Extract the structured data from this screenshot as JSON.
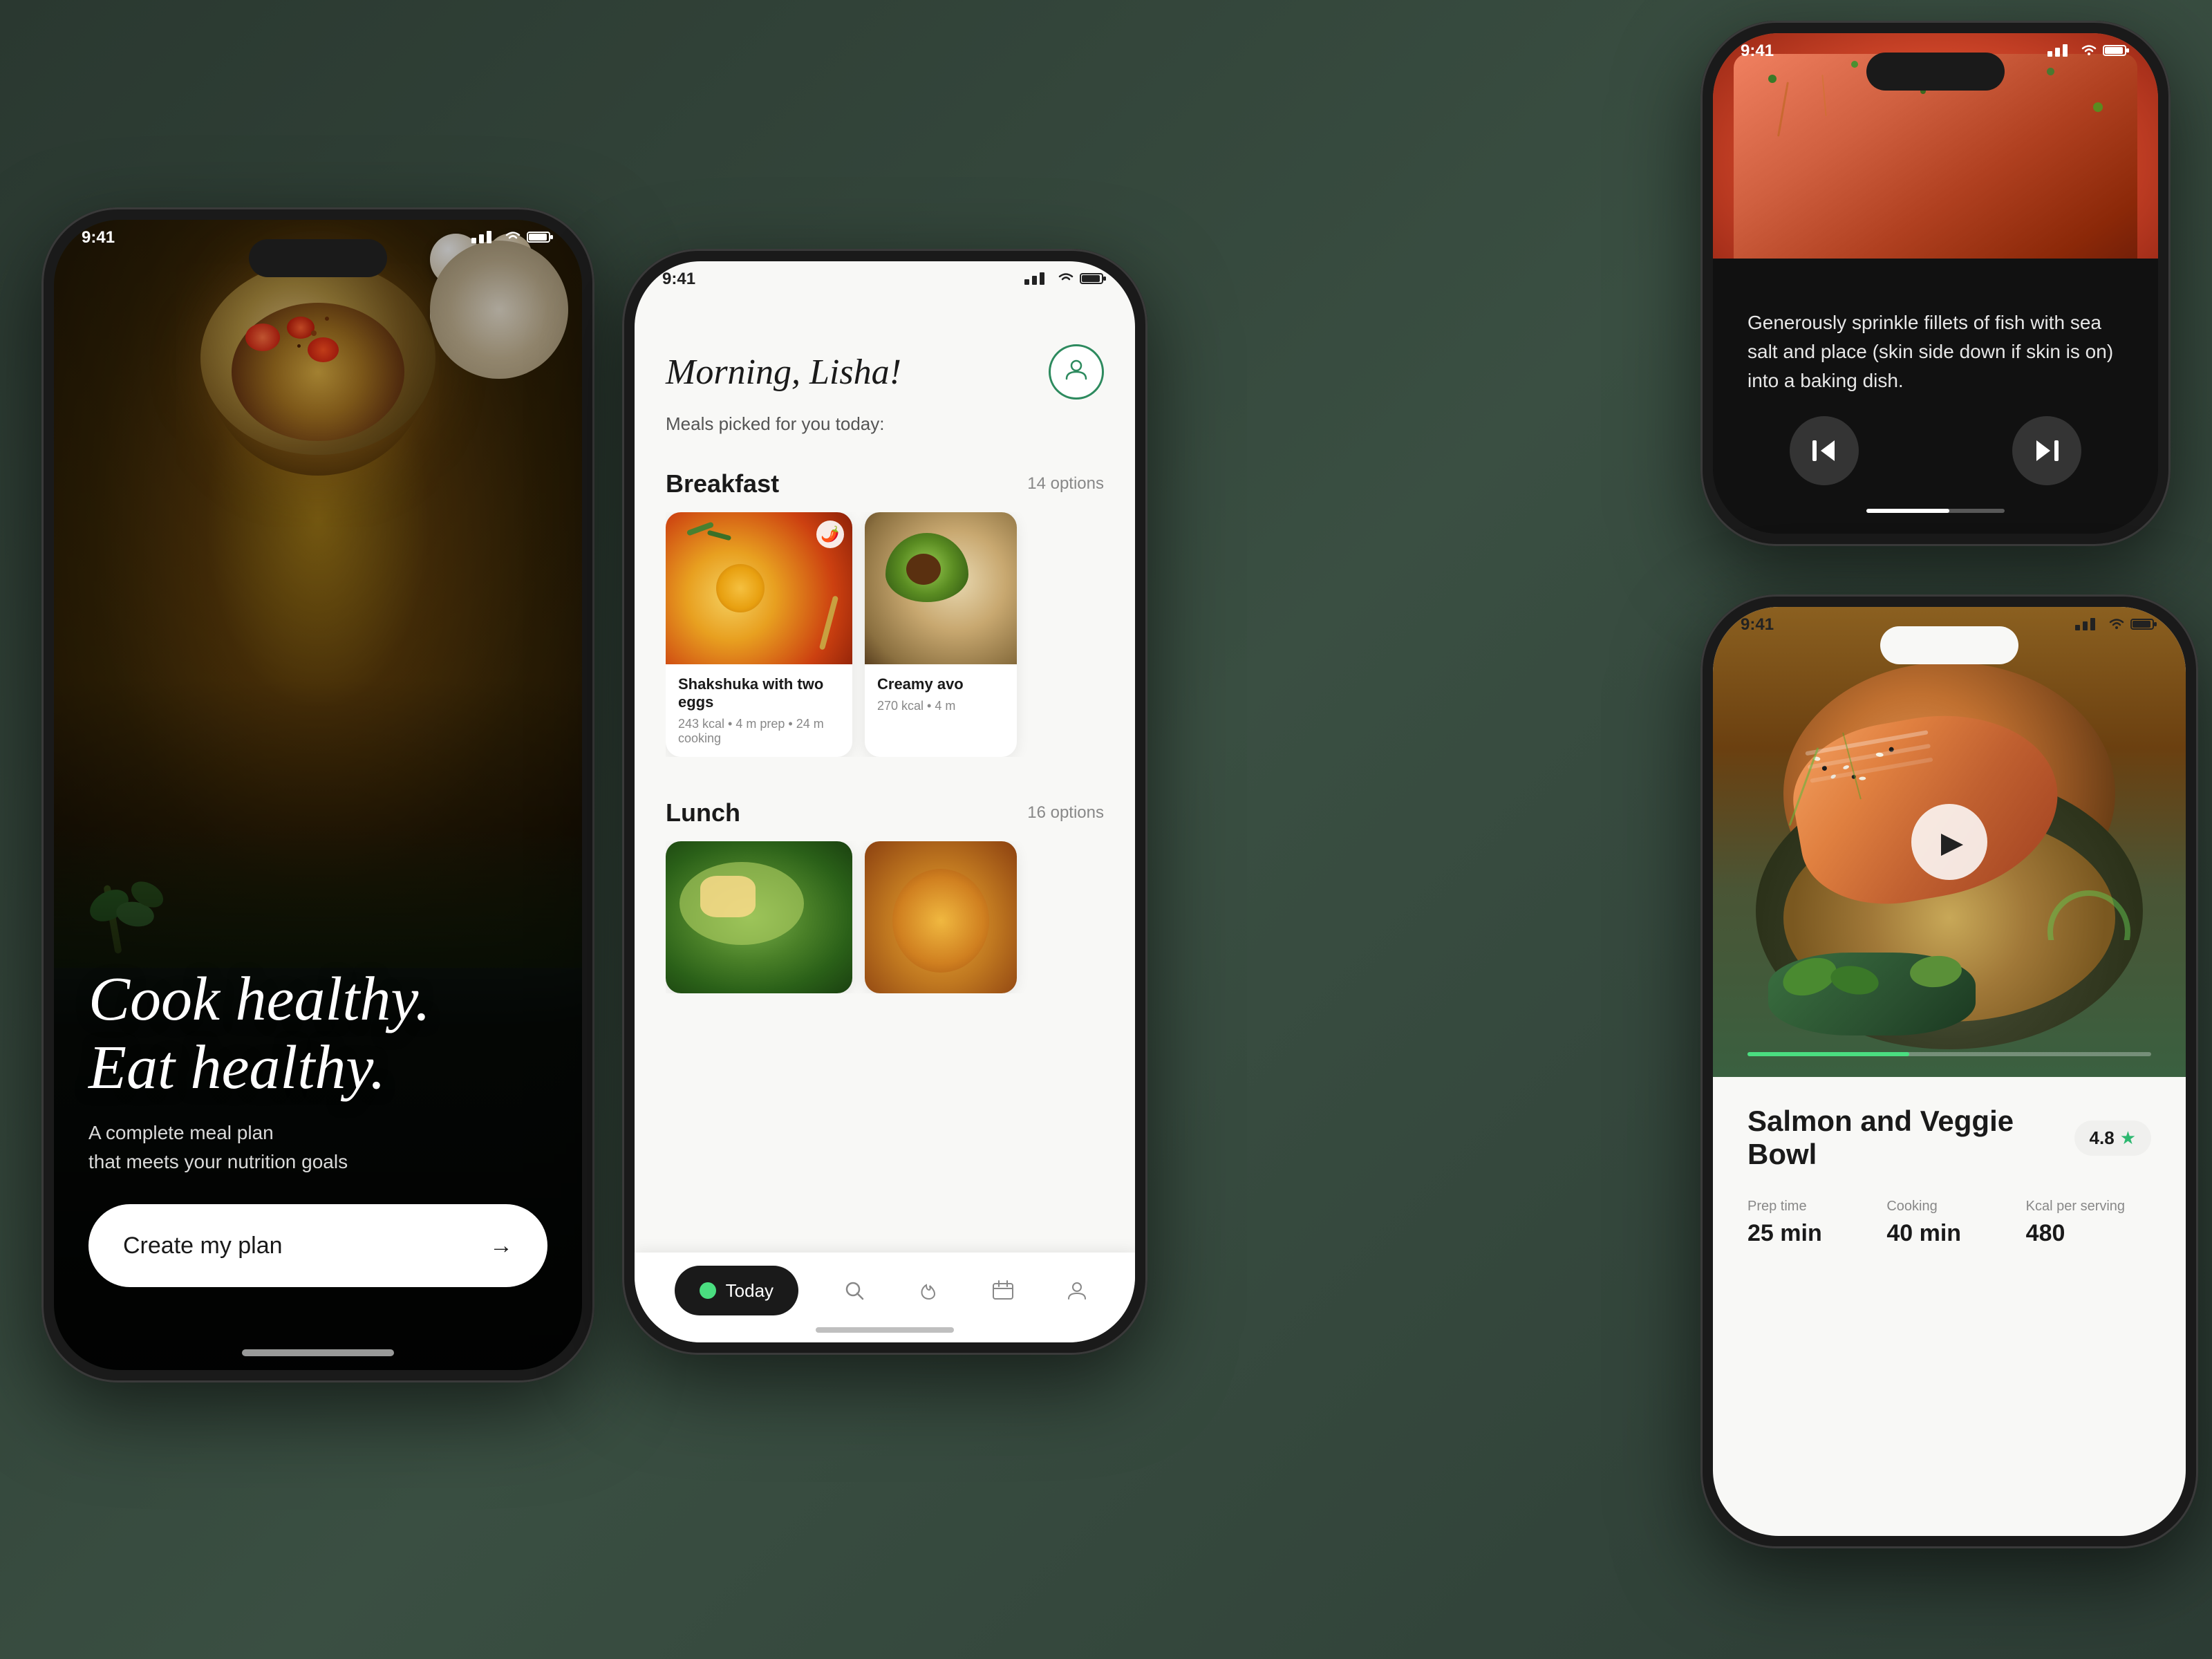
{
  "bg": {
    "color": "#2d3d35"
  },
  "phone1": {
    "status": {
      "time": "9:41",
      "color_class": "white"
    },
    "headline_line1": "Cook healthy.",
    "headline_line2": "Eat healthy.",
    "subtitle_line1": "A complete meal plan",
    "subtitle_line2": "that meets your nutrition goals",
    "cta_label": "Create my plan",
    "cta_arrow": "→"
  },
  "phone2": {
    "status": {
      "time": "9:41",
      "color_class": "dark"
    },
    "greeting": "Morning, Lisha!",
    "subtitle": "Meals picked for you today:",
    "breakfast": {
      "title": "Breakfast",
      "options": "14 options",
      "cards": [
        {
          "name": "Shakshuka with two eggs",
          "kcal": "243 kcal",
          "prep": "4 m prep",
          "cook": "24 m cooking",
          "spicy": true
        },
        {
          "name": "Creamy avo",
          "kcal": "270 kcal",
          "prep": "4 m",
          "cook": "",
          "spicy": false
        }
      ]
    },
    "lunch": {
      "title": "Lunch",
      "options": "16 options"
    },
    "nav": {
      "today_label": "Today",
      "icons": [
        "search",
        "flame",
        "calendar",
        "person"
      ]
    }
  },
  "phone3": {
    "status": {
      "time": "9:41",
      "color_class": "white"
    },
    "instruction": "Generously sprinkle fillets of fish with sea salt and place (skin side down if skin is on) into a baking dish.",
    "controls": {
      "prev": "⏮",
      "next": "⏭"
    }
  },
  "phone4": {
    "status": {
      "time": "9:41",
      "color_class": "dark"
    },
    "recipe_name": "Salmon and Veggie Bowl",
    "rating": "4.8",
    "stats": [
      {
        "label": "Prep time",
        "value": "25 min"
      },
      {
        "label": "Cooking",
        "value": "40 min"
      },
      {
        "label": "Kcal per serving",
        "value": "480"
      }
    ]
  }
}
